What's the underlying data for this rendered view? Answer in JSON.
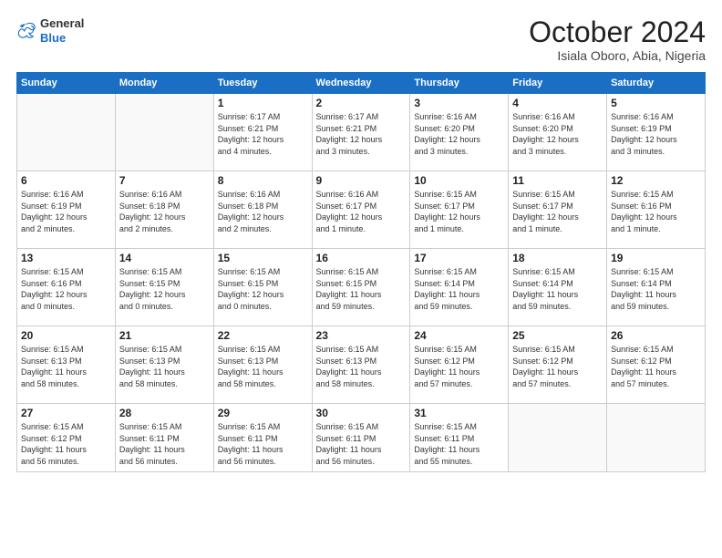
{
  "header": {
    "logo": {
      "general": "General",
      "blue": "Blue"
    },
    "title": "October 2024",
    "location": "Isiala Oboro, Abia, Nigeria"
  },
  "weekdays": [
    "Sunday",
    "Monday",
    "Tuesday",
    "Wednesday",
    "Thursday",
    "Friday",
    "Saturday"
  ],
  "weeks": [
    [
      {
        "day": "",
        "info": ""
      },
      {
        "day": "",
        "info": ""
      },
      {
        "day": "1",
        "info": "Sunrise: 6:17 AM\nSunset: 6:21 PM\nDaylight: 12 hours\nand 4 minutes."
      },
      {
        "day": "2",
        "info": "Sunrise: 6:17 AM\nSunset: 6:21 PM\nDaylight: 12 hours\nand 3 minutes."
      },
      {
        "day": "3",
        "info": "Sunrise: 6:16 AM\nSunset: 6:20 PM\nDaylight: 12 hours\nand 3 minutes."
      },
      {
        "day": "4",
        "info": "Sunrise: 6:16 AM\nSunset: 6:20 PM\nDaylight: 12 hours\nand 3 minutes."
      },
      {
        "day": "5",
        "info": "Sunrise: 6:16 AM\nSunset: 6:19 PM\nDaylight: 12 hours\nand 3 minutes."
      }
    ],
    [
      {
        "day": "6",
        "info": "Sunrise: 6:16 AM\nSunset: 6:19 PM\nDaylight: 12 hours\nand 2 minutes."
      },
      {
        "day": "7",
        "info": "Sunrise: 6:16 AM\nSunset: 6:18 PM\nDaylight: 12 hours\nand 2 minutes."
      },
      {
        "day": "8",
        "info": "Sunrise: 6:16 AM\nSunset: 6:18 PM\nDaylight: 12 hours\nand 2 minutes."
      },
      {
        "day": "9",
        "info": "Sunrise: 6:16 AM\nSunset: 6:17 PM\nDaylight: 12 hours\nand 1 minute."
      },
      {
        "day": "10",
        "info": "Sunrise: 6:15 AM\nSunset: 6:17 PM\nDaylight: 12 hours\nand 1 minute."
      },
      {
        "day": "11",
        "info": "Sunrise: 6:15 AM\nSunset: 6:17 PM\nDaylight: 12 hours\nand 1 minute."
      },
      {
        "day": "12",
        "info": "Sunrise: 6:15 AM\nSunset: 6:16 PM\nDaylight: 12 hours\nand 1 minute."
      }
    ],
    [
      {
        "day": "13",
        "info": "Sunrise: 6:15 AM\nSunset: 6:16 PM\nDaylight: 12 hours\nand 0 minutes."
      },
      {
        "day": "14",
        "info": "Sunrise: 6:15 AM\nSunset: 6:15 PM\nDaylight: 12 hours\nand 0 minutes."
      },
      {
        "day": "15",
        "info": "Sunrise: 6:15 AM\nSunset: 6:15 PM\nDaylight: 12 hours\nand 0 minutes."
      },
      {
        "day": "16",
        "info": "Sunrise: 6:15 AM\nSunset: 6:15 PM\nDaylight: 11 hours\nand 59 minutes."
      },
      {
        "day": "17",
        "info": "Sunrise: 6:15 AM\nSunset: 6:14 PM\nDaylight: 11 hours\nand 59 minutes."
      },
      {
        "day": "18",
        "info": "Sunrise: 6:15 AM\nSunset: 6:14 PM\nDaylight: 11 hours\nand 59 minutes."
      },
      {
        "day": "19",
        "info": "Sunrise: 6:15 AM\nSunset: 6:14 PM\nDaylight: 11 hours\nand 59 minutes."
      }
    ],
    [
      {
        "day": "20",
        "info": "Sunrise: 6:15 AM\nSunset: 6:13 PM\nDaylight: 11 hours\nand 58 minutes."
      },
      {
        "day": "21",
        "info": "Sunrise: 6:15 AM\nSunset: 6:13 PM\nDaylight: 11 hours\nand 58 minutes."
      },
      {
        "day": "22",
        "info": "Sunrise: 6:15 AM\nSunset: 6:13 PM\nDaylight: 11 hours\nand 58 minutes."
      },
      {
        "day": "23",
        "info": "Sunrise: 6:15 AM\nSunset: 6:13 PM\nDaylight: 11 hours\nand 58 minutes."
      },
      {
        "day": "24",
        "info": "Sunrise: 6:15 AM\nSunset: 6:12 PM\nDaylight: 11 hours\nand 57 minutes."
      },
      {
        "day": "25",
        "info": "Sunrise: 6:15 AM\nSunset: 6:12 PM\nDaylight: 11 hours\nand 57 minutes."
      },
      {
        "day": "26",
        "info": "Sunrise: 6:15 AM\nSunset: 6:12 PM\nDaylight: 11 hours\nand 57 minutes."
      }
    ],
    [
      {
        "day": "27",
        "info": "Sunrise: 6:15 AM\nSunset: 6:12 PM\nDaylight: 11 hours\nand 56 minutes."
      },
      {
        "day": "28",
        "info": "Sunrise: 6:15 AM\nSunset: 6:11 PM\nDaylight: 11 hours\nand 56 minutes."
      },
      {
        "day": "29",
        "info": "Sunrise: 6:15 AM\nSunset: 6:11 PM\nDaylight: 11 hours\nand 56 minutes."
      },
      {
        "day": "30",
        "info": "Sunrise: 6:15 AM\nSunset: 6:11 PM\nDaylight: 11 hours\nand 56 minutes."
      },
      {
        "day": "31",
        "info": "Sunrise: 6:15 AM\nSunset: 6:11 PM\nDaylight: 11 hours\nand 55 minutes."
      },
      {
        "day": "",
        "info": ""
      },
      {
        "day": "",
        "info": ""
      }
    ]
  ]
}
